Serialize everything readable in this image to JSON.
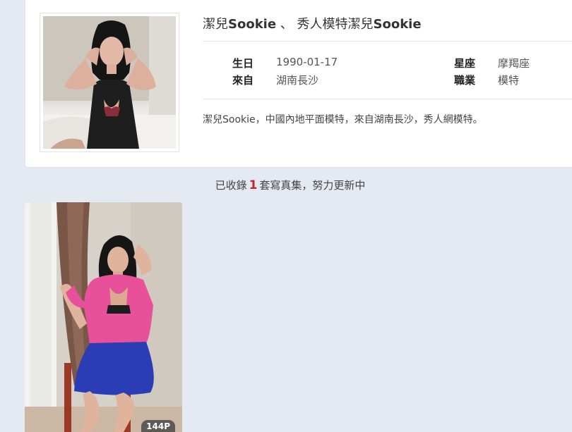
{
  "profile": {
    "name_prefix": "潔兒",
    "name_bold": "Sookie",
    "separator": " 、 ",
    "title_prefix": "秀人模特潔兒",
    "title_bold": "Sookie",
    "birthday_label": "生日",
    "birthday_value": "1990-01-17",
    "origin_label": "來自",
    "origin_value": "湖南長沙",
    "zodiac_label": "星座",
    "zodiac_value": "摩羯座",
    "job_label": "職業",
    "job_value": "模特",
    "bio": "潔兒Sookie，中國內地平面模特，來自湖南長沙，秀人網模特。"
  },
  "albums_summary": {
    "prefix": "已收錄",
    "count": "1",
    "suffix": "套寫真集，努力更新中"
  },
  "album": {
    "page_count": "144P"
  },
  "colors": {
    "page_background": "#e4e9f2",
    "card_background": "#ffffff",
    "count_accent": "#c0272d"
  }
}
